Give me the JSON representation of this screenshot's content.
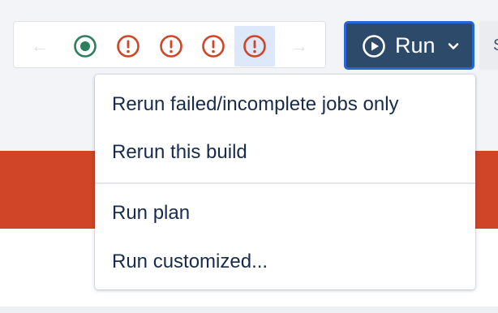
{
  "toolbar": {
    "prev_arrow": "←",
    "next_arrow": "→",
    "builds": [
      {
        "status": "success",
        "icon": "success-circle-icon",
        "color": "#2e7d5b"
      },
      {
        "status": "failed",
        "icon": "failed-exclamation-icon",
        "color": "#d04427"
      },
      {
        "status": "failed",
        "icon": "failed-exclamation-icon",
        "color": "#d04427"
      },
      {
        "status": "failed",
        "icon": "failed-exclamation-icon",
        "color": "#d04427"
      },
      {
        "status": "failed",
        "icon": "failed-exclamation-icon",
        "color": "#d04427",
        "current": true
      }
    ]
  },
  "run_button": {
    "label": "Run",
    "icon": "play-circle-icon",
    "dropdown_icon": "chevron-down-icon",
    "background": "#2e4a6b",
    "border": "#2667d8"
  },
  "side_button": {
    "label": "S"
  },
  "dropdown": {
    "groups": [
      {
        "items": [
          {
            "label": "Rerun failed/incomplete jobs only"
          },
          {
            "label": "Rerun this build"
          }
        ]
      },
      {
        "items": [
          {
            "label": "Run plan"
          },
          {
            "label": "Run customized..."
          }
        ]
      }
    ]
  },
  "colors": {
    "page_background": "#f3f4f8",
    "failed_banner": "#d04427",
    "text": "#172b4d"
  }
}
